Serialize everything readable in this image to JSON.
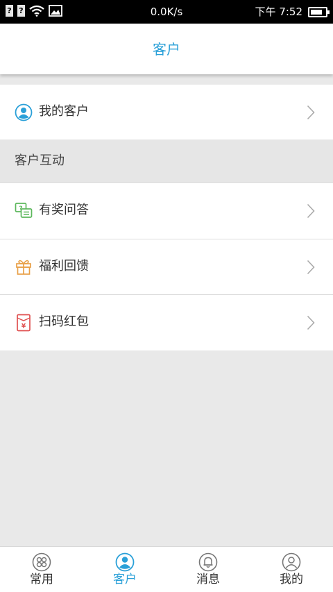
{
  "status_bar": {
    "left_icons": [
      "sim-unknown-icon",
      "sim-unknown-icon",
      "wifi-icon",
      "image-icon"
    ],
    "sim_glyph": "?",
    "net_speed": "0.0K/s",
    "time": "下午 7:52",
    "battery_level": 0.8
  },
  "header": {
    "title": "客户"
  },
  "rows": {
    "my_customers": {
      "label": "我的客户",
      "icon": "customer-icon"
    },
    "reward_qa": {
      "label": "有奖问答",
      "icon": "chat-question-icon"
    },
    "benefit_feedback": {
      "label": "福利回馈",
      "icon": "gift-icon"
    },
    "scan_red_packet": {
      "label": "扫码红包",
      "icon": "red-packet-icon"
    }
  },
  "section": {
    "title": "客户互动"
  },
  "colors": {
    "accent": "#2aa0d8",
    "green": "#5cb85c",
    "orange": "#e8a048",
    "red": "#e05050"
  },
  "bottom_nav": {
    "items": [
      {
        "label": "常用",
        "icon": "apps-icon"
      },
      {
        "label": "客户",
        "icon": "customer-icon",
        "active": true
      },
      {
        "label": "消息",
        "icon": "bell-icon"
      },
      {
        "label": "我的",
        "icon": "profile-icon"
      }
    ]
  }
}
